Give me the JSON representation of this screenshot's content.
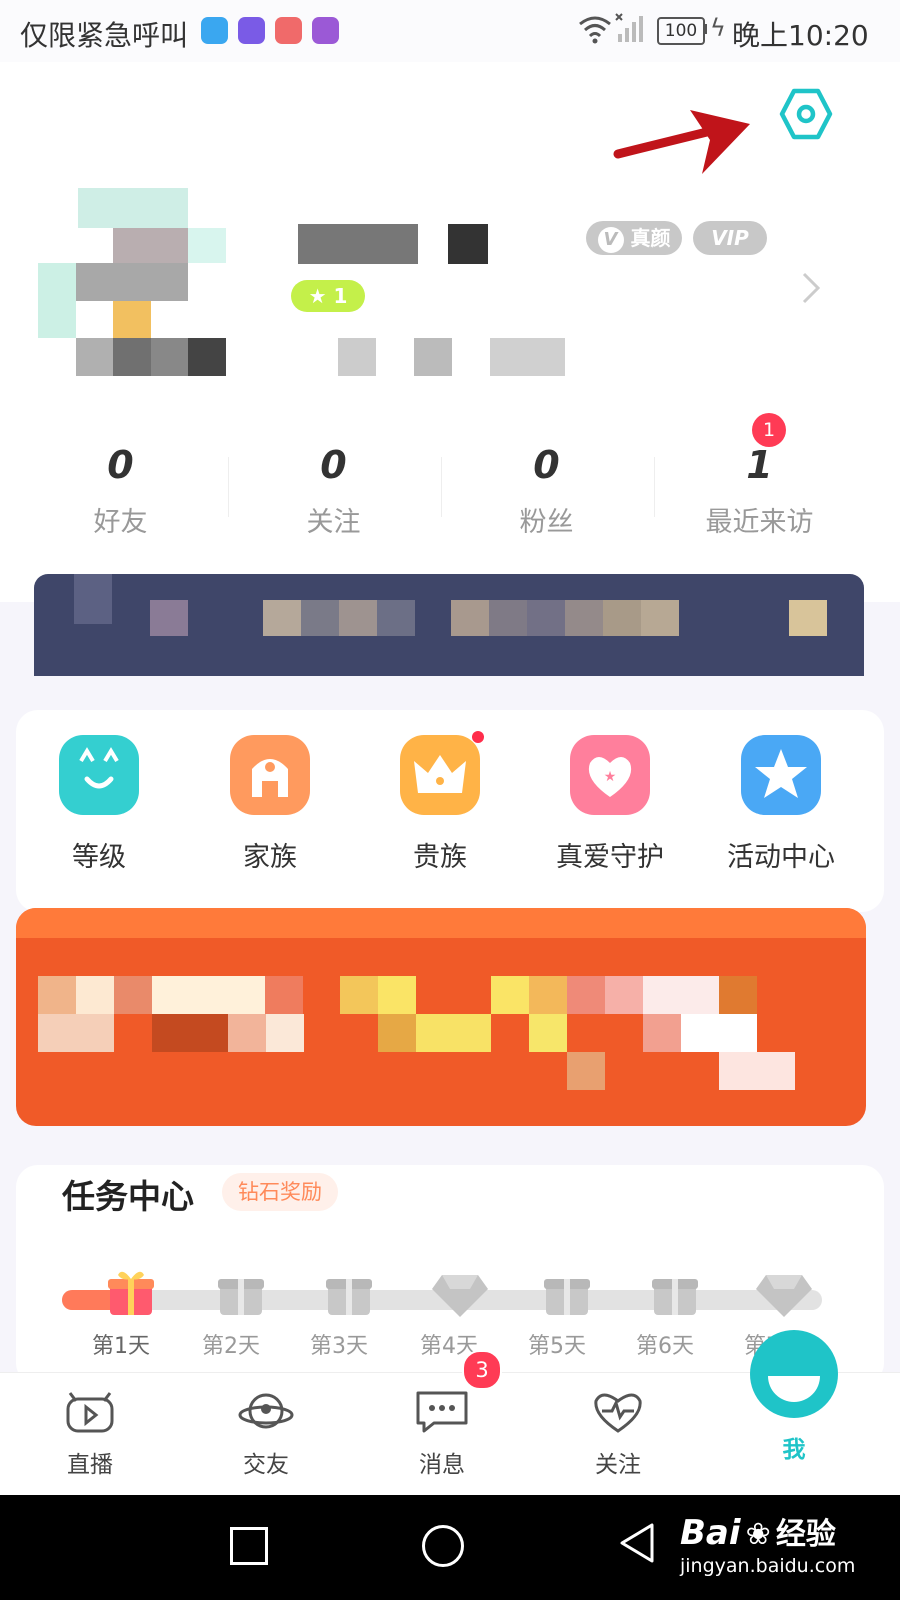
{
  "status_bar": {
    "carrier_text": "仅限紧急呼叫",
    "battery": "100",
    "time": "晚上10:20"
  },
  "profile": {
    "level_badge": "1",
    "badge_real": "真颜",
    "badge_vip": "VIP"
  },
  "stats": [
    {
      "num": "0",
      "label": "好友"
    },
    {
      "num": "0",
      "label": "关注"
    },
    {
      "num": "0",
      "label": "粉丝"
    },
    {
      "num": "1",
      "label": "最近来访"
    }
  ],
  "stats_badge": "1",
  "quick_menu": [
    {
      "label": "等级",
      "icon": "cat-face-icon",
      "color": "#34cfd0"
    },
    {
      "label": "家族",
      "icon": "family-castle-icon",
      "color": "#ff9a5e"
    },
    {
      "label": "贵族",
      "icon": "crown-icon",
      "color": "#ffb347"
    },
    {
      "label": "真爱守护",
      "icon": "heart-shield-icon",
      "color": "#ff7f9c"
    },
    {
      "label": "活动中心",
      "icon": "star-icon",
      "color": "#4aa8f5"
    }
  ],
  "task_center": {
    "title": "任务中心",
    "tag": "钻石奖励",
    "days": [
      "第1天",
      "第2天",
      "第3天",
      "第4天",
      "第5天",
      "第6天",
      "第7天"
    ]
  },
  "tabs": [
    {
      "label": "直播",
      "icon": "live-tv-icon"
    },
    {
      "label": "交友",
      "icon": "friend-planet-icon"
    },
    {
      "label": "消息",
      "icon": "message-bubble-icon",
      "badge": "3"
    },
    {
      "label": "关注",
      "icon": "heartbeat-icon"
    },
    {
      "label": "我",
      "icon": "me-face-icon",
      "active": true
    }
  ],
  "watermark": {
    "brand": "Bai",
    "brand_suffix": "经验",
    "url": "jingyan.baidu.com"
  },
  "colors": {
    "accent": "#1fc4c8",
    "annotation_arrow": "#c0141a",
    "badge_red": "#ff3b55"
  }
}
